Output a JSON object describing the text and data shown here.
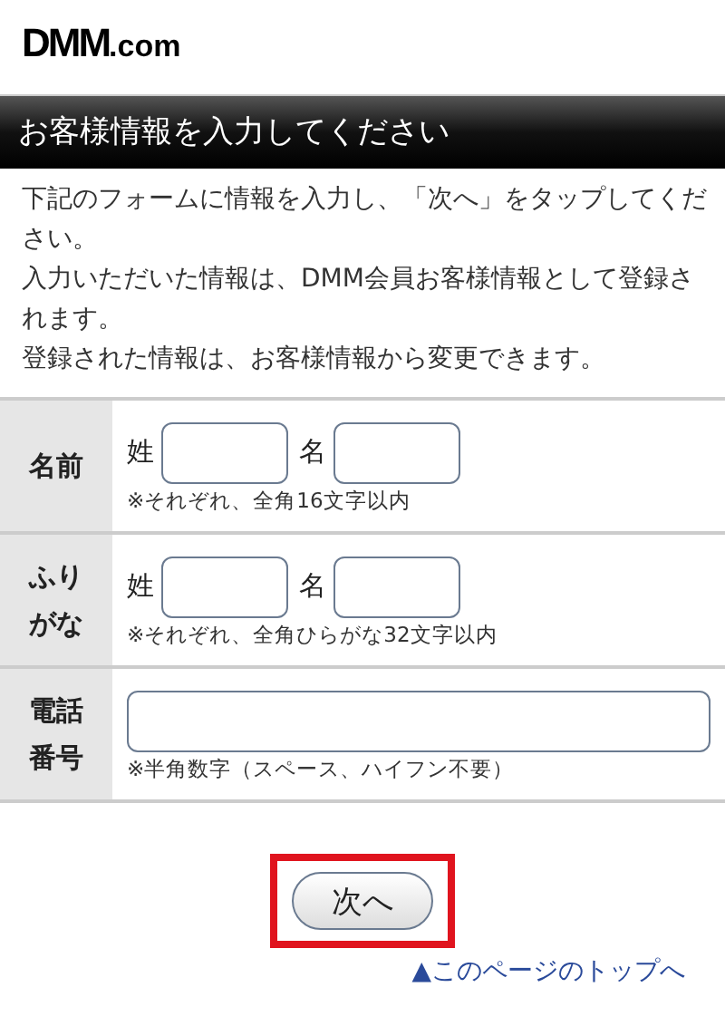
{
  "logo": {
    "main": "DMM",
    "suffix": ".com"
  },
  "heading": "お客様情報を入力してください",
  "intro": [
    "下記のフォームに情報を入力し、「次へ」をタップしてください。",
    "入力いただいた情報は、DMM会員お客様情報として登録されます。",
    "登録された情報は、お客様情報から変更できます。"
  ],
  "rows": [
    {
      "kind": "pair",
      "label": [
        "名前"
      ],
      "first_label": "姓",
      "last_label": "名",
      "note": "※それぞれ、全角16文字以内"
    },
    {
      "kind": "pair",
      "label": [
        "ふり",
        "がな"
      ],
      "first_label": "姓",
      "last_label": "名",
      "note": "※それぞれ、全角ひらがな32文字以内"
    },
    {
      "kind": "single",
      "label": [
        "電話",
        "番号"
      ],
      "note": "※半角数字（スペース、ハイフン不要）"
    }
  ],
  "next_button": {
    "label": "次へ",
    "highlighted": true
  },
  "top_link": "▲このページのトップへ"
}
